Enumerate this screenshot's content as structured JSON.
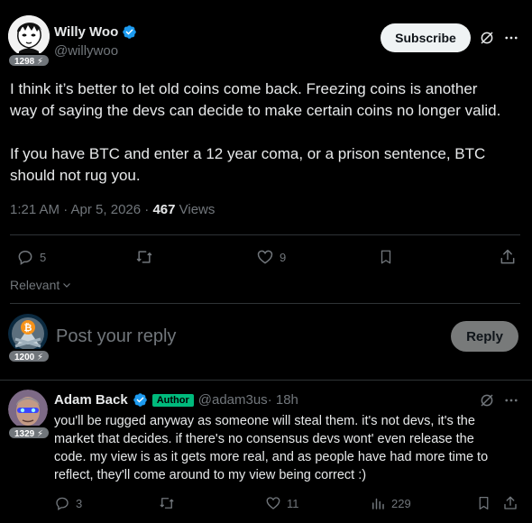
{
  "post": {
    "author_name": "Willy Woo",
    "handle": "@willywoo",
    "score_badge": "1298",
    "subscribe_label": "Subscribe",
    "text_line1": "I think it’s better to let old coins come back. Freezing coins is another",
    "text_line2": "way of saying the devs can decide to make certain coins no longer valid.",
    "text_line3": "If you have BTC and enter a 12 year coma, or a prison sentence, BTC",
    "text_line4": "should not rug you.",
    "timestamp": "1:21 AM · Apr 5, 2026 · ",
    "views_count": "467",
    "views_label": " Views",
    "replies": "5",
    "likes": "9"
  },
  "sort": {
    "label": "Relevant"
  },
  "composer": {
    "placeholder": "Post your reply",
    "score_badge": "1200",
    "reply_label": "Reply"
  },
  "reply": {
    "author_name": "Adam Back",
    "author_tag": "Author",
    "handle": "@adam3us",
    "time": " · 18h",
    "score_badge": "1329",
    "line1": "you'll be rugged anyway as someone will steal them. it's not devs, it's the",
    "line2": "market that decides. if there's no consensus devs wont' even release the",
    "line3": "code. my view is as it gets more real, and as people have had more time to",
    "line4": "reflect, they'll come around to my view being correct :)",
    "replies": "3",
    "likes": "11",
    "views": "229"
  },
  "colors": {
    "accent": "#1d9bf0",
    "author_tag": "#00ba7c",
    "muted": "#71767b",
    "divider": "#2f3336"
  }
}
